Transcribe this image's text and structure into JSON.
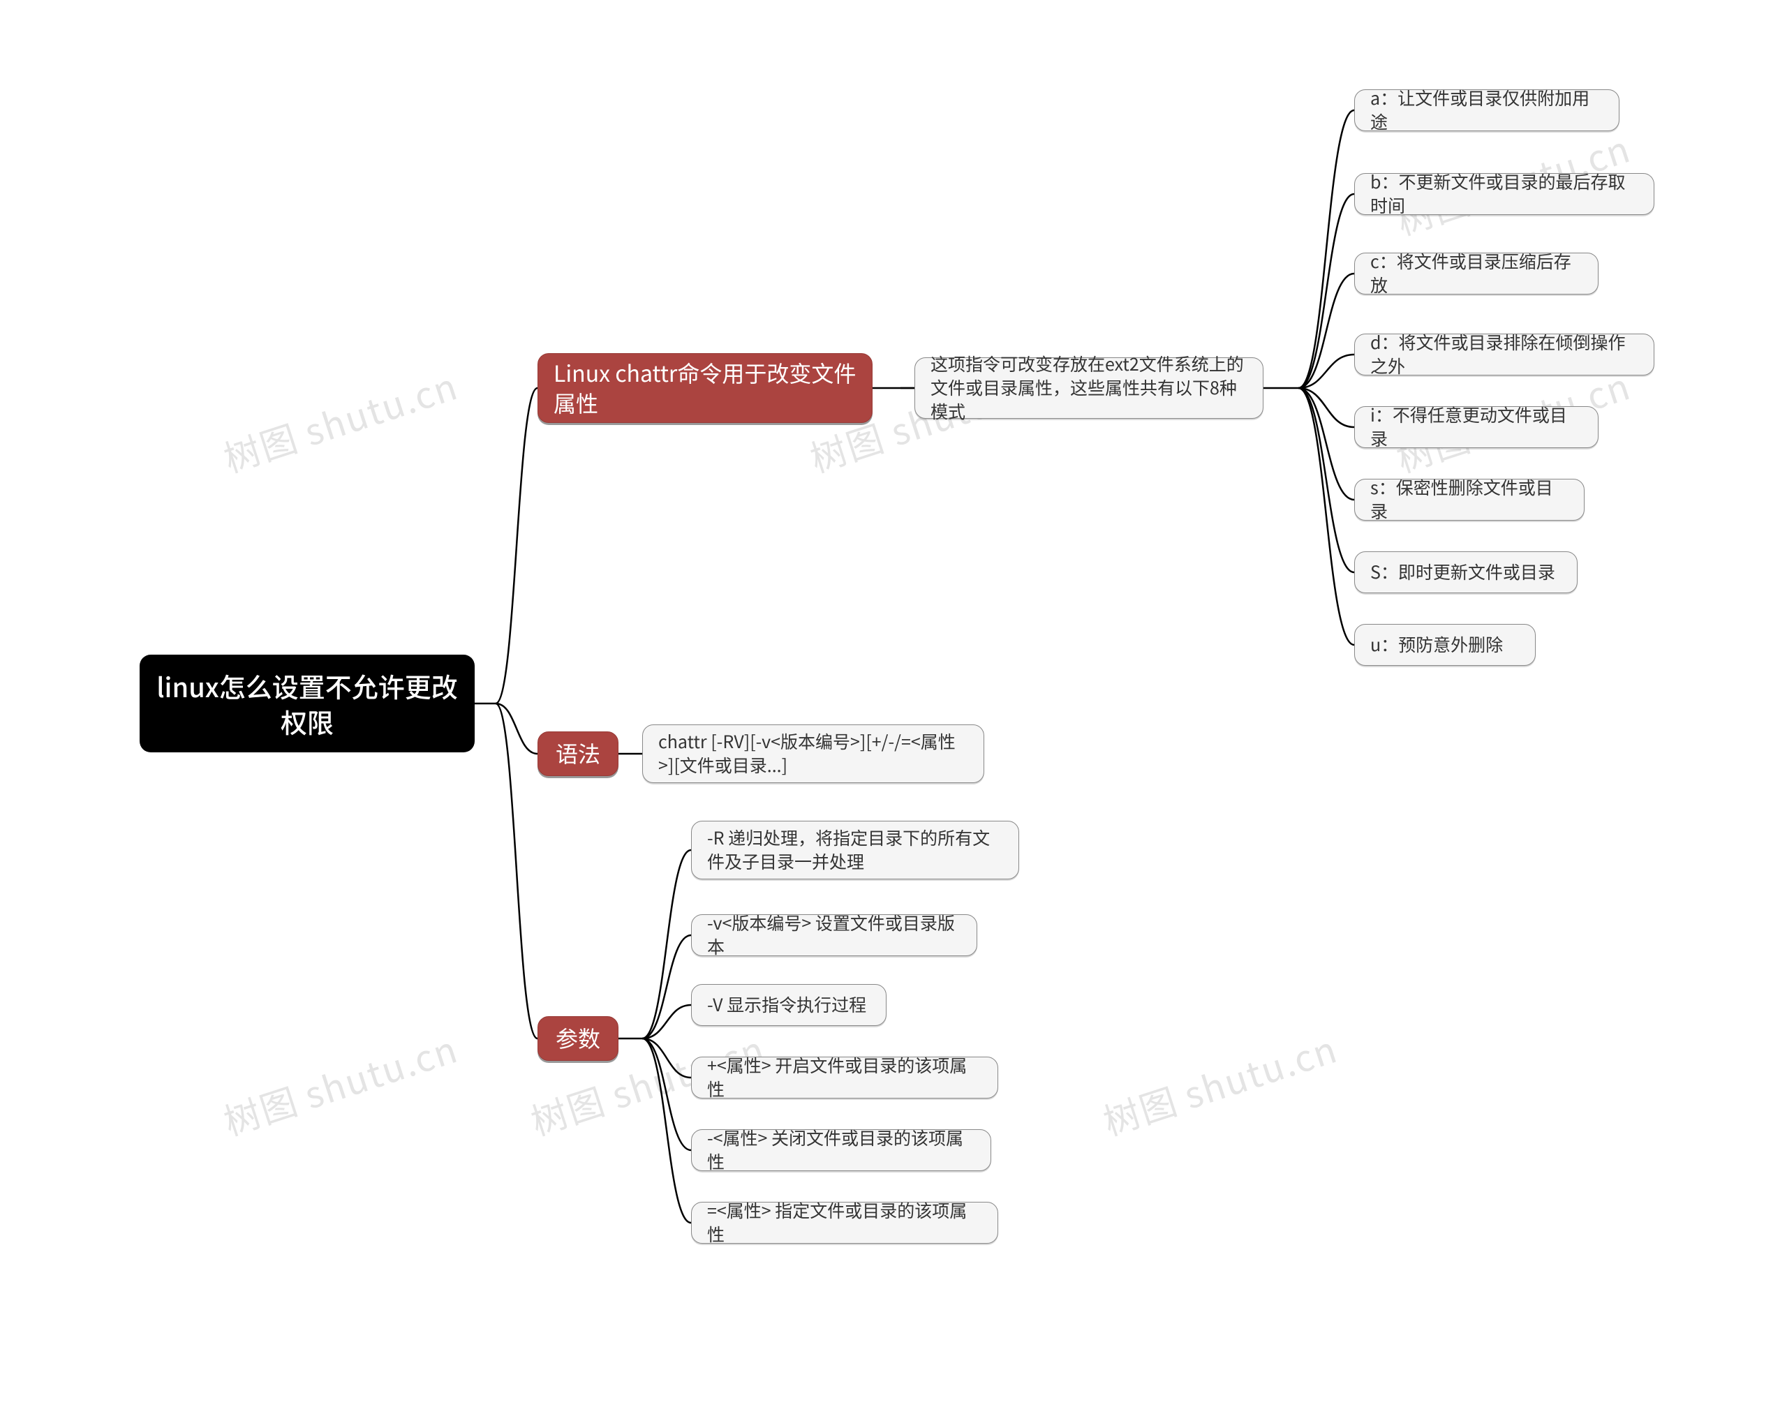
{
  "root": {
    "title": "linux怎么设置不允许更改权限"
  },
  "branch_1": {
    "label": "Linux chattr命令用于改变文件属性",
    "note": "这项指令可改变存放在ext2文件系统上的文件或目录属性，这些属性共有以下8种模式",
    "modes": [
      "a：让文件或目录仅供附加用途",
      "b：不更新文件或目录的最后存取时间",
      "c：将文件或目录压缩后存放",
      "d：将文件或目录排除在倾倒操作之外",
      "i：不得任意更动文件或目录",
      "s：保密性删除文件或目录",
      "S：即时更新文件或目录",
      "u：预防意外删除"
    ]
  },
  "branch_2": {
    "label": "语法",
    "syntax": "chattr [-RV][-v<版本编号>][+/-/=<属性>][文件或目录...]"
  },
  "branch_3": {
    "label": "参数",
    "params": [
      "-R 递归处理，将指定目录下的所有文件及子目录一并处理",
      "-v<版本编号> 设置文件或目录版本",
      "-V 显示指令执行过程",
      "+<属性> 开启文件或目录的该项属性",
      "-<属性> 关闭文件或目录的该项属性",
      "=<属性> 指定文件或目录的该项属性"
    ]
  },
  "watermark": "树图 shutu.cn"
}
